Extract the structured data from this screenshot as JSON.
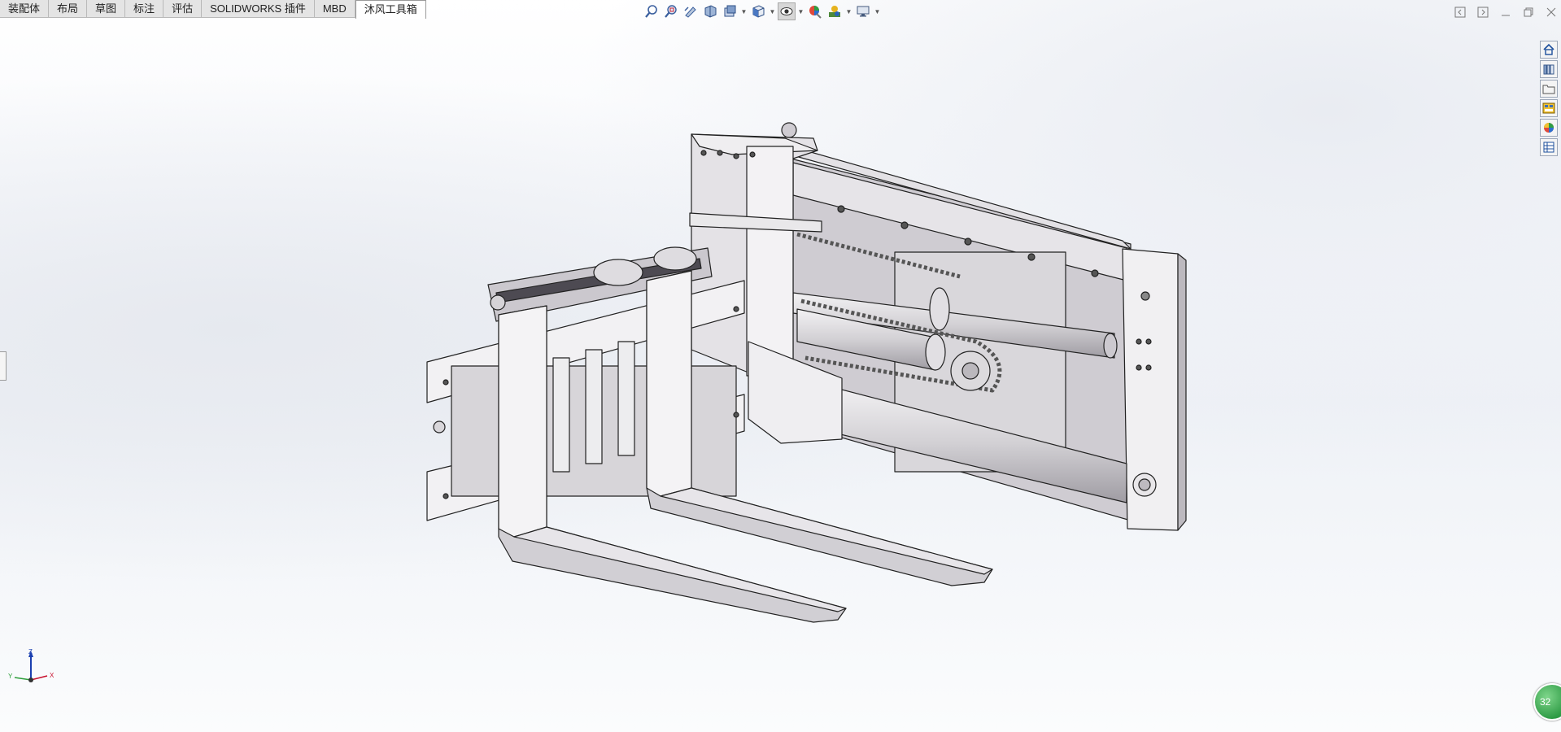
{
  "tabs": [
    {
      "label": "装配体",
      "active": false
    },
    {
      "label": "布局",
      "active": false
    },
    {
      "label": "草图",
      "active": false
    },
    {
      "label": "标注",
      "active": false
    },
    {
      "label": "评估",
      "active": false
    },
    {
      "label": "SOLIDWORKS 插件",
      "active": false
    },
    {
      "label": "MBD",
      "active": false
    },
    {
      "label": "沐风工具箱",
      "active": true
    }
  ],
  "hud_icons": [
    "zoom-to-fit-icon",
    "zoom-to-area-icon",
    "previous-view-icon",
    "section-view-icon",
    "dynamic-annotation-icon",
    "view-orientation-icon",
    "display-style-icon",
    "hide-show-icon",
    "edit-appearance-icon",
    "apply-scene-icon",
    "view-settings-icon"
  ],
  "task_pane_icons": [
    "home-icon",
    "design-library-icon",
    "file-explorer-icon",
    "view-palette-icon",
    "appearances-icon",
    "custom-properties-icon"
  ],
  "triad": {
    "x": "X",
    "y": "Y",
    "z": "Z"
  },
  "badge_text": "32",
  "colors": {
    "accent": "#0a5cc4",
    "badge": "#2e9b45",
    "part_fill": "#e6e4e7",
    "part_shade": "#b9b6bb"
  }
}
